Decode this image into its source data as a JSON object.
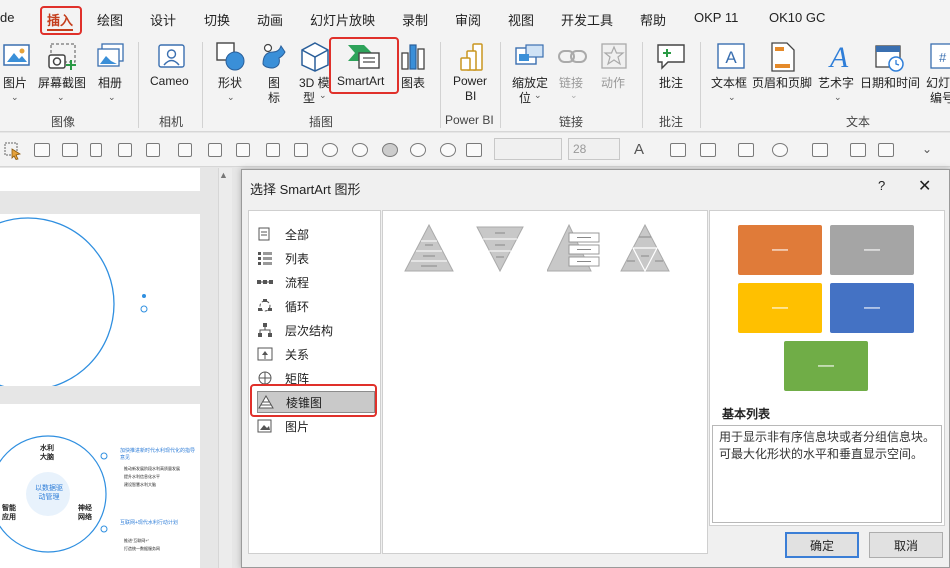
{
  "menu": {
    "tabs": [
      "de",
      "插入",
      "绘图",
      "设计",
      "切换",
      "动画",
      "幻灯片放映",
      "录制",
      "审阅",
      "视图",
      "开发工具",
      "帮助",
      "OKP 11",
      "OK10 GC"
    ],
    "active_tab": "插入"
  },
  "ribbon": {
    "image_group": {
      "picture": "图片",
      "screenshot": "屏幕截图",
      "album": "相册",
      "label": "图像"
    },
    "camera_group": {
      "cameo": "Cameo",
      "label": "相机"
    },
    "illustration_group": {
      "shapes": "形状",
      "icons_1": "图",
      "icons_2": "标",
      "model_1": "3D 模",
      "model_2": "型",
      "smartart": "SmartArt",
      "chart": "图表",
      "label": "插图"
    },
    "powerbi_group": {
      "powerbi_1": "Power",
      "powerbi_2": "BI",
      "label": "Power BI"
    },
    "links_group": {
      "zoom_1": "缩放定",
      "zoom_2": "位",
      "link": "链接",
      "action": "动作",
      "label": "链接"
    },
    "comments_group": {
      "comment": "批注",
      "label": "批注"
    },
    "text_group": {
      "textbox": "文本框",
      "header_footer": "页眉和页脚",
      "wordart": "艺术字",
      "datetime": "日期和时间",
      "slide_num_1": "幻灯",
      "slide_num_2": "编号",
      "label": "文本"
    }
  },
  "toolbar2": {
    "font_size": "28"
  },
  "slides": {
    "slide2": {
      "center": "以数据驱动管理",
      "node_top": "水利大脑",
      "node_left": "智能应用",
      "node_right": "神经网络",
      "side_1": "加快推进新时代水利现代化的指导意见",
      "side_1a": "推动新发展阶段水利高质量发展",
      "side_1b": "提升水利信息化水平",
      "side_1c": "建设智慧水利大脑",
      "side_2": "互联网+现代水利行动计划",
      "side_2a": "推进“互联网+”",
      "side_2b": "打造统一数据服务网"
    }
  },
  "dialog": {
    "title": "选择 SmartArt 图形",
    "help": "?",
    "close": "✕",
    "categories": [
      "全部",
      "列表",
      "流程",
      "循环",
      "层次结构",
      "关系",
      "矩阵",
      "棱锥图",
      "图片"
    ],
    "selected_category": "棱锥图",
    "preview": {
      "title": "基本列表",
      "description": "用于显示非有序信息块或者分组信息块。可最大化形状的水平和垂直显示空间。",
      "box_text": "—",
      "colors": [
        "#e07b39",
        "#a5a5a5",
        "#ffc000",
        "#4472c4",
        "#70ad47"
      ]
    },
    "ok": "确定",
    "cancel": "取消"
  }
}
